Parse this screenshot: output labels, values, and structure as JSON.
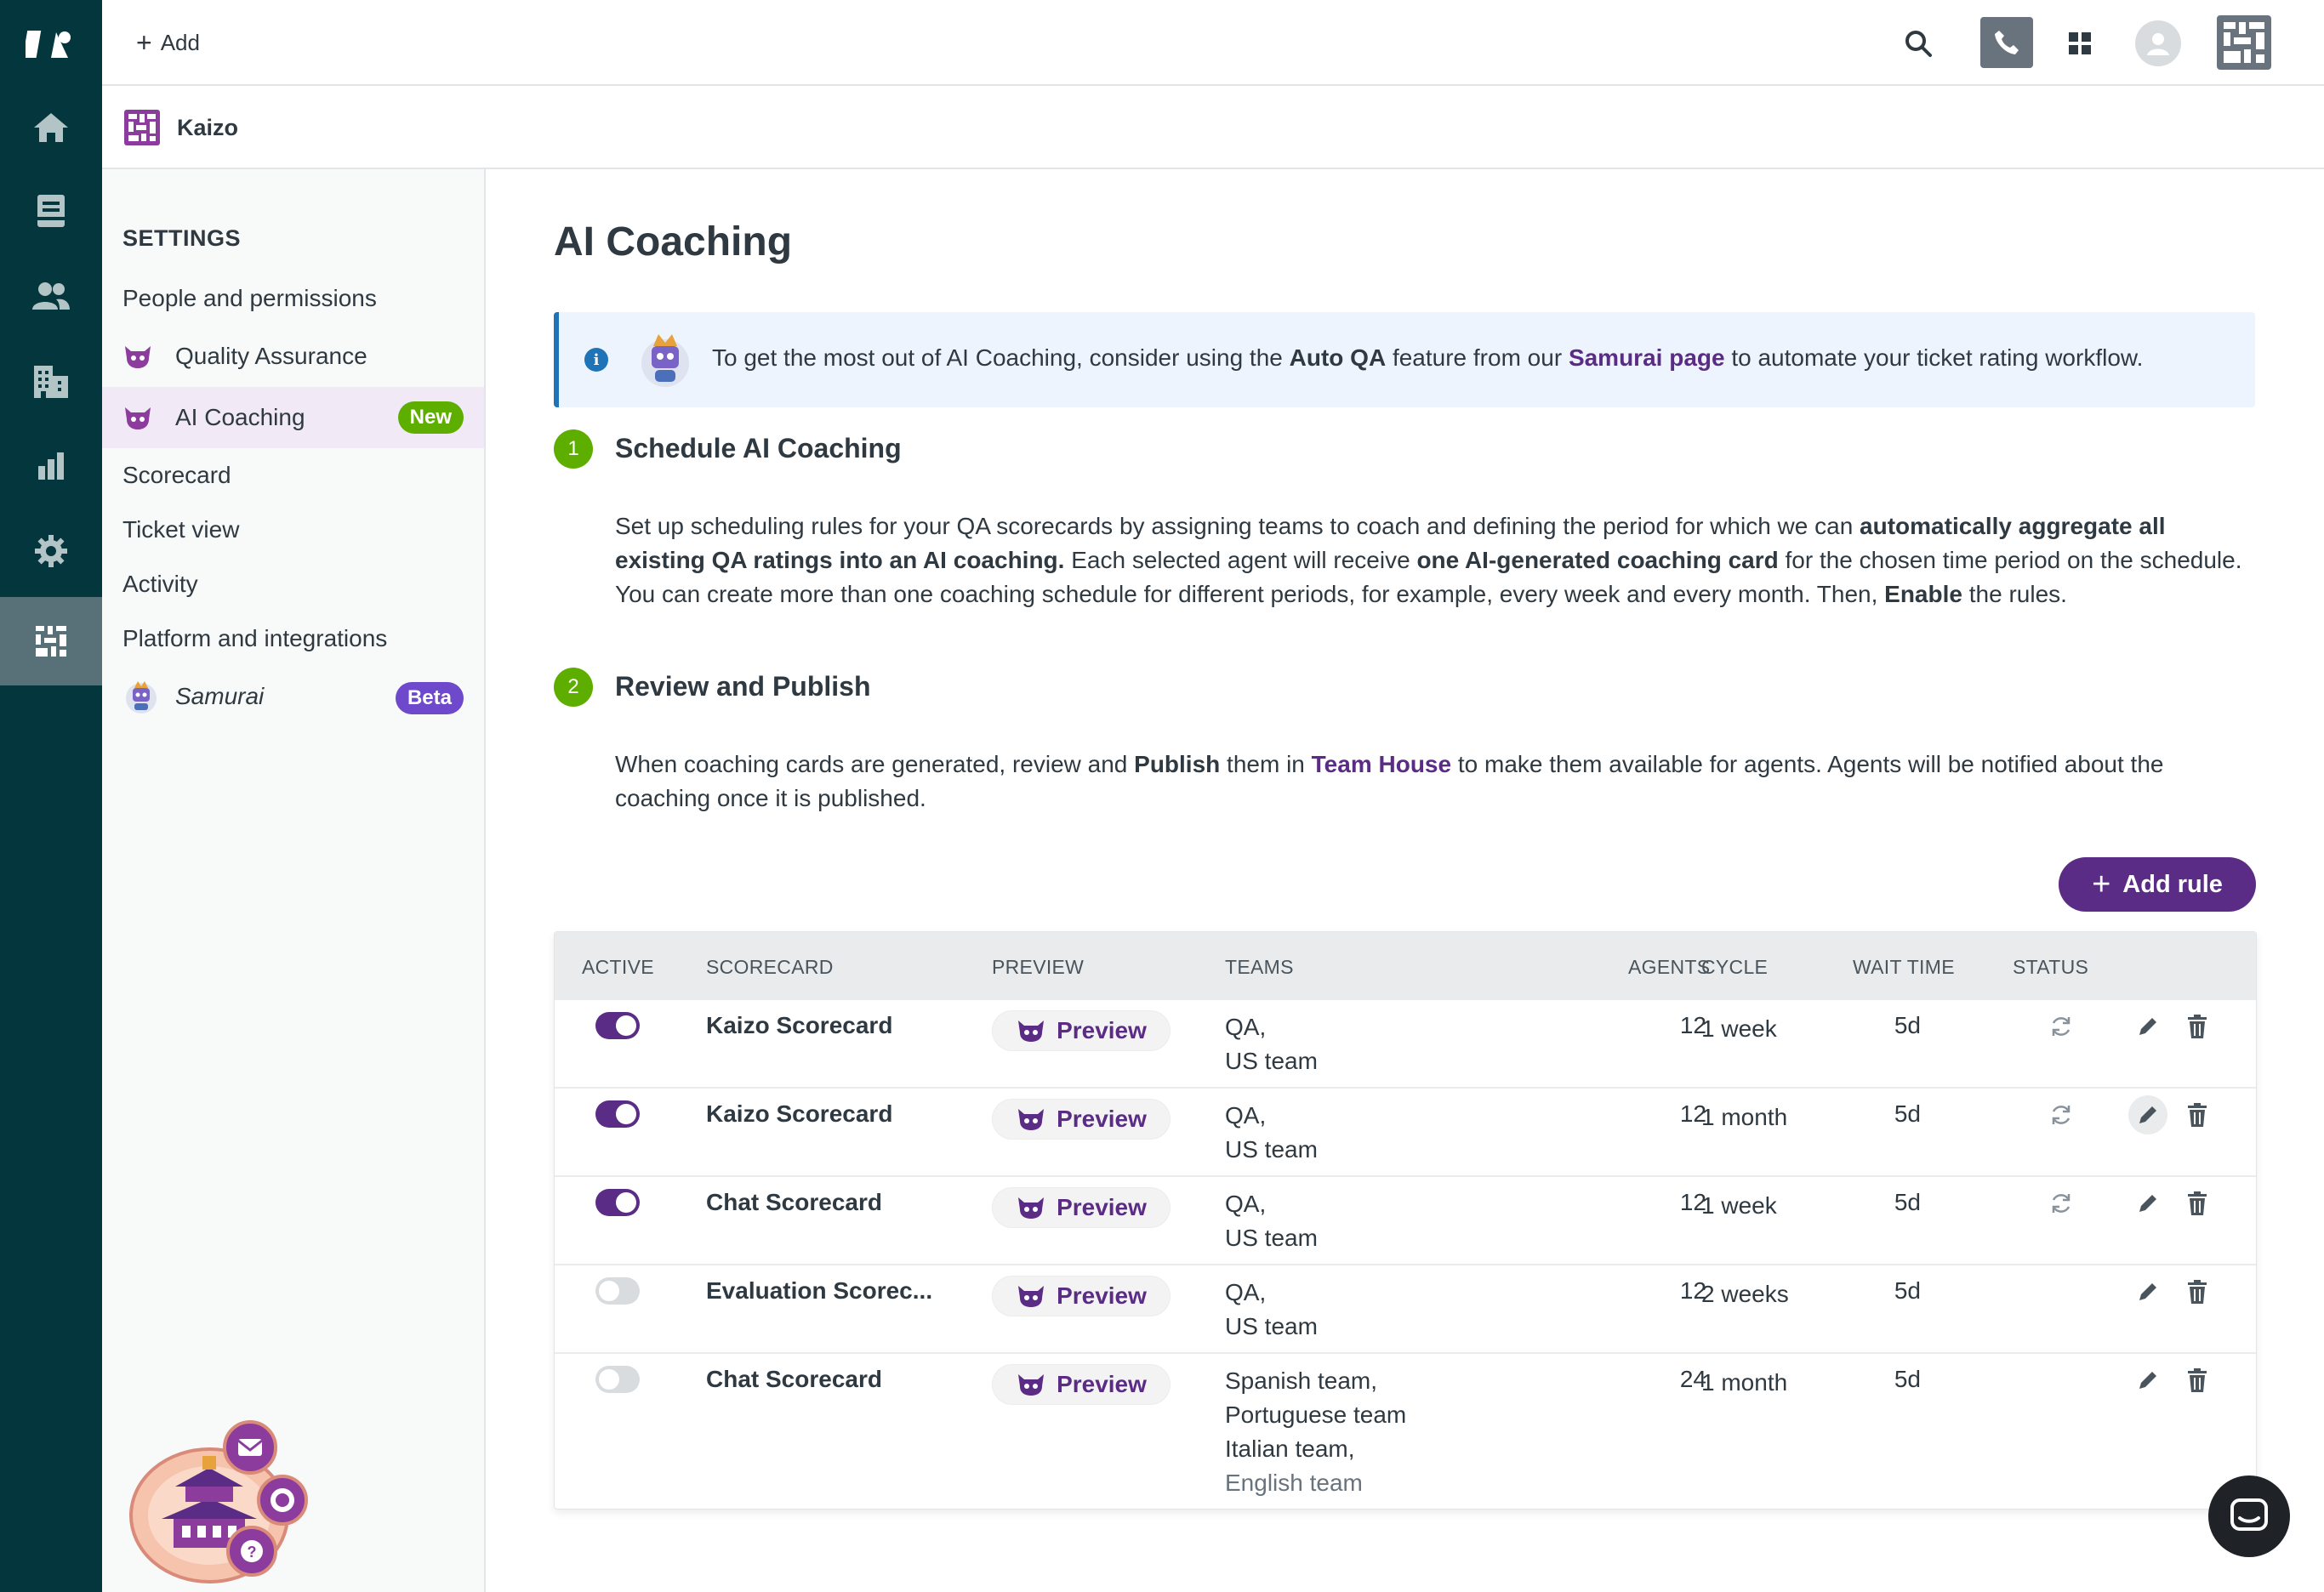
{
  "header": {
    "add_label": "Add",
    "account_name": "Kaizo"
  },
  "rail": {
    "icons": [
      "logo-icon",
      "home-icon",
      "tickets-icon",
      "users-icon",
      "organizations-icon",
      "reports-icon",
      "gear-icon",
      "kaizo-app-icon"
    ]
  },
  "sidebar": {
    "heading": "SETTINGS",
    "items": [
      {
        "label": "People and permissions"
      },
      {
        "label": "Quality Assurance"
      },
      {
        "label": "AI Coaching",
        "badge": "New"
      },
      {
        "label": "Scorecard"
      },
      {
        "label": "Ticket view"
      },
      {
        "label": "Activity"
      },
      {
        "label": "Platform and integrations"
      },
      {
        "label": "Samurai",
        "badge": "Beta"
      }
    ]
  },
  "main": {
    "title": "AI Coaching",
    "banner": {
      "pre": "To get the most out of AI Coaching, consider using the ",
      "bold1": "Auto QA",
      "mid": " feature from our ",
      "link": "Samurai page",
      "post": " to automate your ticket rating workflow."
    },
    "step1": {
      "number": "1",
      "title": "Schedule AI Coaching",
      "t1": "Set up scheduling rules for your QA scorecards by assigning teams to coach and defining the period for which we can ",
      "b1": "automatically aggregate all existing QA ratings into an AI coaching.",
      "t2": " Each selected agent will receive ",
      "b2": "one AI-generated coaching card",
      "t3": " for the chosen time period on the schedule. You can create more than one coaching schedule for different periods, for example, every week and every month. Then, ",
      "b3": "Enable",
      "t4": " the rules."
    },
    "step2": {
      "number": "2",
      "title": "Review and Publish",
      "t1": "When coaching cards are generated, review and ",
      "b1": "Publish",
      "t2": " them in ",
      "link": "Team House",
      "t3": " to make them available for agents. Agents will be notified about the coaching once it is published."
    },
    "add_rule_label": "Add rule"
  },
  "table": {
    "columns": [
      "ACTIVE",
      "SCORECARD",
      "PREVIEW",
      "TEAMS",
      "AGENTS",
      "CYCLE",
      "WAIT TIME",
      "STATUS"
    ],
    "preview_label": "Preview",
    "rows": [
      {
        "active": true,
        "scorecard": "Kaizo Scorecard",
        "teams": [
          "QA,",
          "US team"
        ],
        "agents": "12",
        "cycle": "1 week",
        "wait": "5d",
        "status": "refresh-icon"
      },
      {
        "active": true,
        "scorecard": "Kaizo Scorecard",
        "teams": [
          "QA,",
          "US team"
        ],
        "agents": "12",
        "cycle": "1 month",
        "wait": "5d",
        "status": "refresh-icon"
      },
      {
        "active": true,
        "scorecard": "Chat Scorecard",
        "teams": [
          "QA,",
          "US team"
        ],
        "agents": "12",
        "cycle": "1 week",
        "wait": "5d",
        "status": "refresh-icon"
      },
      {
        "active": false,
        "scorecard": "Evaluation Scorec...",
        "teams": [
          "QA,",
          "US team"
        ],
        "agents": "12",
        "cycle": "2 weeks",
        "wait": "5d",
        "status": ""
      },
      {
        "active": false,
        "scorecard": "Chat Scorecard",
        "teams": [
          "Spanish team,",
          "Portuguese team",
          "Italian team,",
          "English team"
        ],
        "agents": "24",
        "cycle": "1 month",
        "wait": "5d",
        "status": ""
      }
    ]
  },
  "colors": {
    "rail_bg": "#03363d",
    "accent_purple": "#5b2c86",
    "step_green": "#5eae00",
    "badge_new": "#5eae00",
    "badge_beta": "#6e49cb",
    "info_blue": "#1f73b7"
  }
}
